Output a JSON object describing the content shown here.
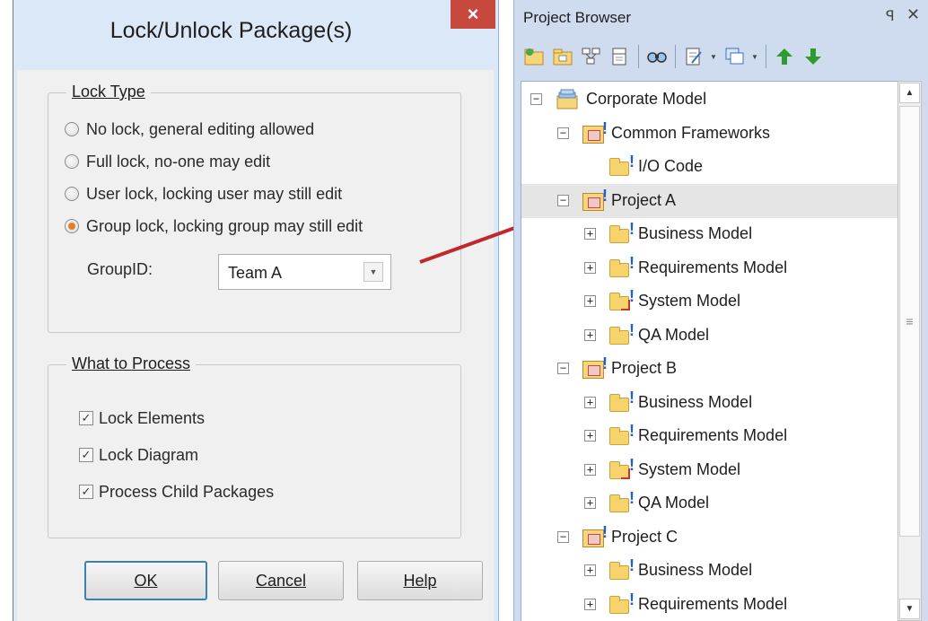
{
  "dialog": {
    "title": "Lock/Unlock Package(s)",
    "close_label": "×",
    "lock_type": {
      "label": "Lock Type",
      "options": [
        {
          "label": "No lock, general editing allowed",
          "checked": false
        },
        {
          "label": "Full lock, no-one may edit",
          "checked": false
        },
        {
          "label": "User lock, locking user may still edit",
          "checked": false
        },
        {
          "label": "Group lock, locking group may still edit",
          "checked": true
        }
      ],
      "group_id_label": "GroupID:",
      "group_id_value": "Team A"
    },
    "what_to_process": {
      "label": "What to Process",
      "options": [
        {
          "label": "Lock Elements",
          "checked": true
        },
        {
          "label": "Lock Diagram",
          "checked": true
        },
        {
          "label": "Process Child Packages",
          "checked": true
        }
      ]
    },
    "buttons": {
      "ok": "OK",
      "cancel": "Cancel",
      "help": "Help"
    }
  },
  "browser": {
    "title": "Project Browser",
    "pin_glyph": "ꟼ",
    "close_glyph": "✕",
    "toolbar_icons": [
      "new-model-icon",
      "new-package-icon",
      "new-diagram-icon",
      "new-element-icon",
      "find-icon",
      "properties-icon",
      "views-icon",
      "move-up-icon",
      "move-down-icon"
    ],
    "tree": [
      {
        "label": "Corporate Model",
        "level": 0,
        "expander": "−",
        "icon": "model-root-icon",
        "locked": false,
        "selected": false
      },
      {
        "label": "Common Frameworks",
        "level": 1,
        "expander": "−",
        "icon": "package-icon",
        "locked": true,
        "selected": false
      },
      {
        "label": "I/O Code",
        "level": 2,
        "expander": "",
        "icon": "folder-icon",
        "locked": true,
        "selected": false
      },
      {
        "label": "Project A",
        "level": 1,
        "expander": "−",
        "icon": "package-icon",
        "locked": true,
        "selected": true
      },
      {
        "label": "Business Model",
        "level": 2,
        "expander": "+",
        "icon": "folder-icon",
        "locked": true,
        "selected": false
      },
      {
        "label": "Requirements Model",
        "level": 2,
        "expander": "+",
        "icon": "folder-icon",
        "locked": true,
        "selected": false
      },
      {
        "label": "System Model",
        "level": 2,
        "expander": "+",
        "icon": "system-folder-icon",
        "locked": true,
        "selected": false
      },
      {
        "label": "QA Model",
        "level": 2,
        "expander": "+",
        "icon": "folder-icon",
        "locked": true,
        "selected": false
      },
      {
        "label": "Project B",
        "level": 1,
        "expander": "−",
        "icon": "package-icon",
        "locked": true,
        "selected": false
      },
      {
        "label": "Business Model",
        "level": 2,
        "expander": "+",
        "icon": "folder-icon",
        "locked": true,
        "selected": false
      },
      {
        "label": "Requirements Model",
        "level": 2,
        "expander": "+",
        "icon": "folder-icon",
        "locked": true,
        "selected": false
      },
      {
        "label": "System Model",
        "level": 2,
        "expander": "+",
        "icon": "system-folder-icon",
        "locked": true,
        "selected": false
      },
      {
        "label": "QA Model",
        "level": 2,
        "expander": "+",
        "icon": "folder-icon",
        "locked": true,
        "selected": false
      },
      {
        "label": "Project C",
        "level": 1,
        "expander": "−",
        "icon": "package-icon",
        "locked": true,
        "selected": false
      },
      {
        "label": "Business Model",
        "level": 2,
        "expander": "+",
        "icon": "folder-icon",
        "locked": true,
        "selected": false
      },
      {
        "label": "Requirements Model",
        "level": 2,
        "expander": "+",
        "icon": "folder-icon",
        "locked": true,
        "selected": false
      }
    ]
  },
  "colors": {
    "titlebar": "#dbe8f7",
    "close_button": "#c7483d",
    "radio_selected": "#e67e22",
    "arrow": "#c0282b",
    "lock_marker": "#1c5fd6"
  }
}
